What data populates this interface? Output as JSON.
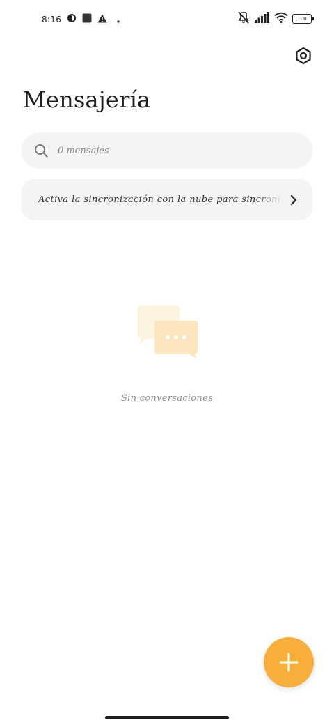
{
  "status_bar": {
    "time": "8:16",
    "battery_level": "100",
    "icons": [
      "data-saver-icon",
      "square-notification-icon",
      "warning-icon",
      "dot-icon",
      "vibrate-icon",
      "signal-icon",
      "wifi-icon",
      "battery-icon"
    ]
  },
  "header": {
    "title": "Mensajería",
    "settings_icon": "settings-hexagon-icon"
  },
  "search": {
    "placeholder": "0 mensajes",
    "value": "",
    "icon": "search-icon"
  },
  "sync_banner": {
    "text": "Activa la sincronización con la nube para sincronizar",
    "icon": "chevron-right-icon"
  },
  "empty_state": {
    "text": "Sin conversaciones",
    "icon": "chat-bubbles-icon"
  },
  "fab": {
    "icon": "plus-icon"
  },
  "colors": {
    "accent": "#f7ae3b",
    "card_bg": "#f4f4f4",
    "illustration_light": "#fdf3e1",
    "illustration_main": "#fce6bf"
  }
}
